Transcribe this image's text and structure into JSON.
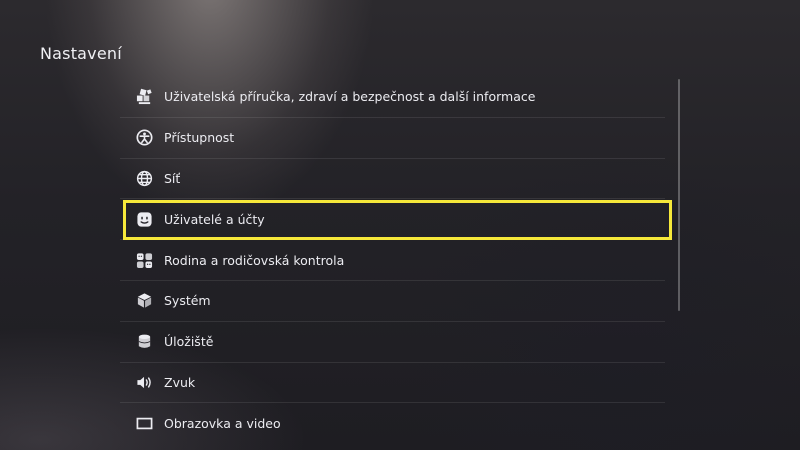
{
  "page": {
    "title": "Nastavení"
  },
  "menu": {
    "items": [
      {
        "label": "Uživatelská příručka, zdraví a bezpečnost a další informace",
        "icon": "manual-icon"
      },
      {
        "label": "Přístupnost",
        "icon": "accessibility-icon"
      },
      {
        "label": "Síť",
        "icon": "globe-icon"
      },
      {
        "label": "Uživatelé a účty",
        "icon": "user-face-icon",
        "focused": true
      },
      {
        "label": "Rodina a rodičovská kontrola",
        "icon": "family-icon"
      },
      {
        "label": "Systém",
        "icon": "cube-icon"
      },
      {
        "label": "Úložiště",
        "icon": "storage-icon"
      },
      {
        "label": "Zvuk",
        "icon": "speaker-icon"
      },
      {
        "label": "Obrazovka a video",
        "icon": "display-icon"
      }
    ]
  },
  "colors": {
    "focus_outline": "#f6e83a",
    "text": "#ececf1",
    "background": "#232227"
  }
}
